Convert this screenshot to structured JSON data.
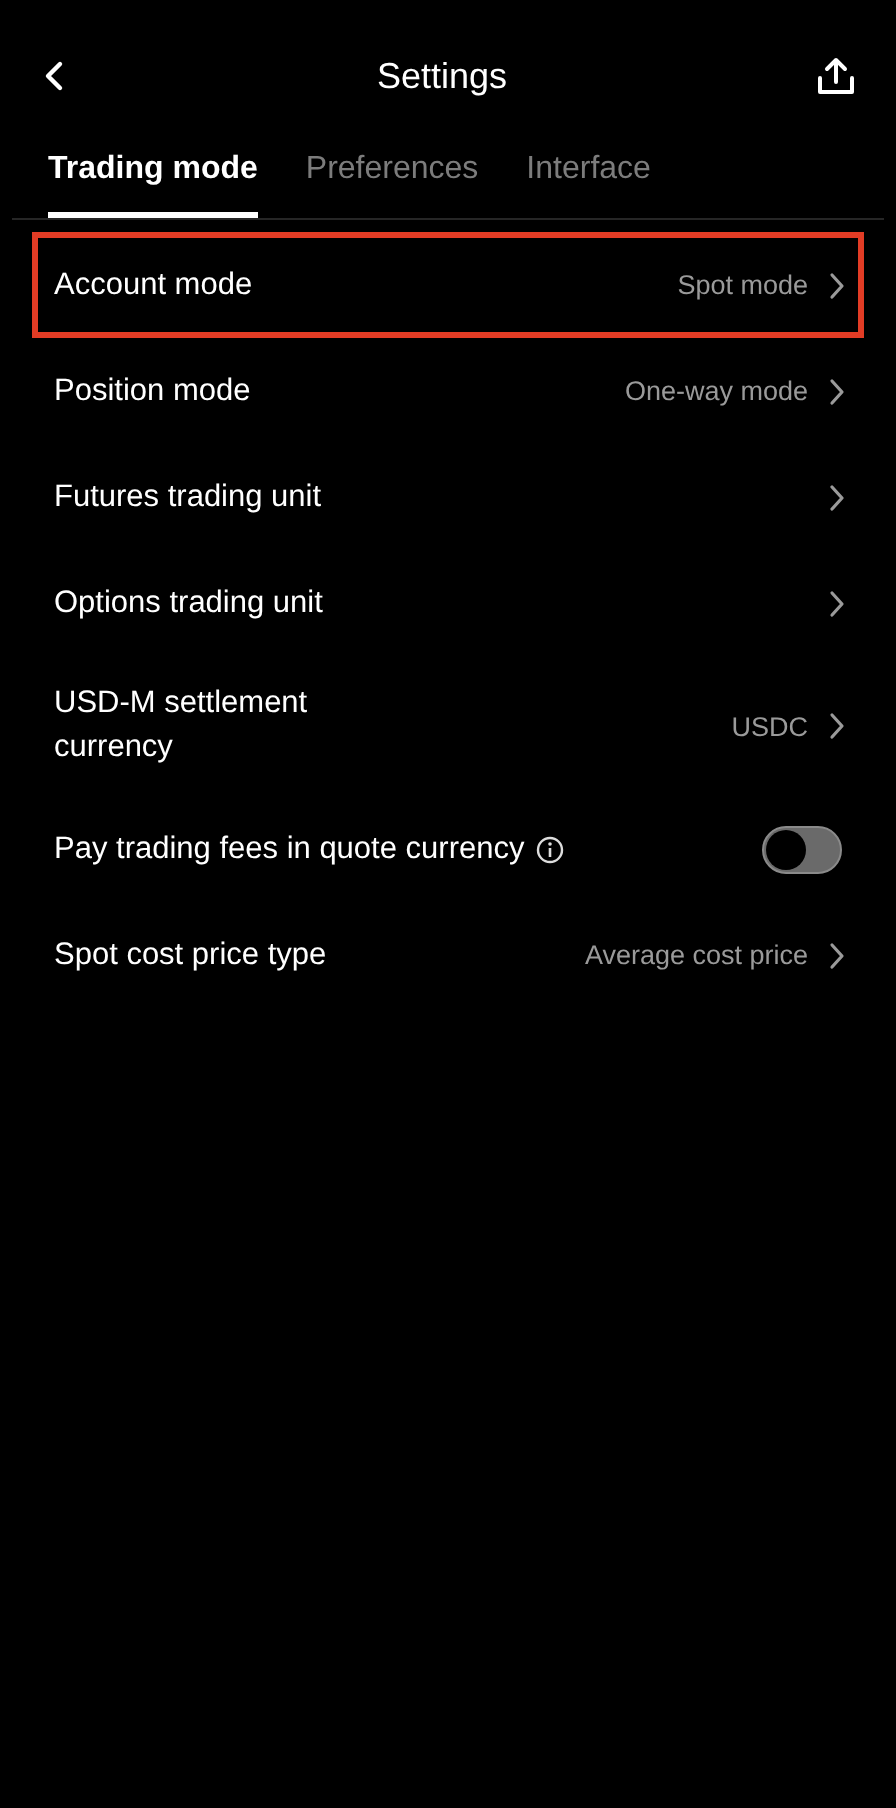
{
  "header": {
    "title": "Settings"
  },
  "tabs": [
    {
      "label": "Trading mode",
      "selected": true
    },
    {
      "label": "Preferences",
      "selected": false
    },
    {
      "label": "Interface",
      "selected": false
    }
  ],
  "settings": [
    {
      "kind": "link",
      "label": "Account mode",
      "value": "Spot mode",
      "highlighted": true
    },
    {
      "kind": "link",
      "label": "Position mode",
      "value": "One-way mode",
      "highlighted": false
    },
    {
      "kind": "link",
      "label": "Futures trading unit",
      "highlighted": false
    },
    {
      "kind": "link",
      "label": "Options trading unit",
      "highlighted": false
    },
    {
      "kind": "link",
      "label": "USD-M settlement currency",
      "value": "USDC",
      "highlighted": false
    },
    {
      "kind": "toggle",
      "label": "Pay trading fees in quote currency",
      "info": true,
      "on": false,
      "highlighted": false
    },
    {
      "kind": "link",
      "label": "Spot cost price type",
      "value": "Average cost price",
      "highlighted": false
    }
  ]
}
